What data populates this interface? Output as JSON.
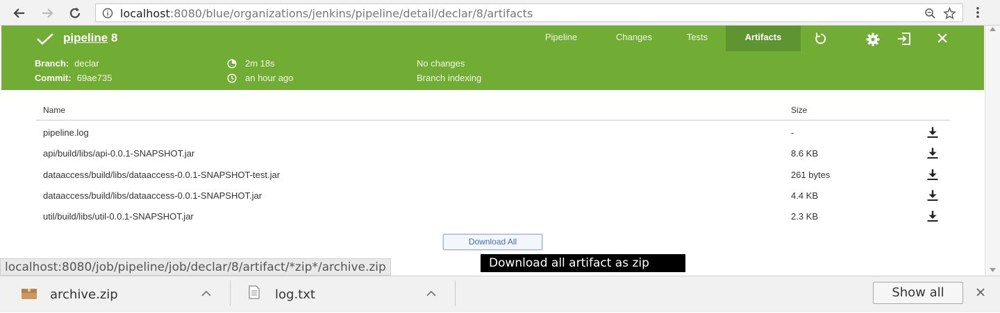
{
  "browser": {
    "url_host": "localhost",
    "url_rest": ":8080/blue/organizations/jenkins/pipeline/detail/declar/8/artifacts"
  },
  "run": {
    "pipeline_name": "pipeline",
    "run_number": "8",
    "status": "success"
  },
  "tabs": [
    {
      "label": "Pipeline",
      "active": false
    },
    {
      "label": "Changes",
      "active": false
    },
    {
      "label": "Tests",
      "active": false
    },
    {
      "label": "Artifacts",
      "active": true
    }
  ],
  "meta": {
    "branch_label": "Branch:",
    "branch_value": "declar",
    "commit_label": "Commit:",
    "commit_value": "69ae735",
    "duration": "2m 18s",
    "started": "an hour ago",
    "changes": "No changes",
    "cause": "Branch indexing"
  },
  "table": {
    "headers": {
      "name": "Name",
      "size": "Size"
    },
    "rows": [
      {
        "name": "pipeline.log",
        "size": "-"
      },
      {
        "name": "api/build/libs/api-0.0.1-SNAPSHOT.jar",
        "size": "8.6 KB"
      },
      {
        "name": "dataaccess/build/libs/dataaccess-0.0.1-SNAPSHOT-test.jar",
        "size": "261 bytes"
      },
      {
        "name": "dataaccess/build/libs/dataaccess-0.0.1-SNAPSHOT.jar",
        "size": "4.4 KB"
      },
      {
        "name": "util/build/libs/util-0.0.1-SNAPSHOT.jar",
        "size": "2.3 KB"
      }
    ]
  },
  "download_all": "Download All",
  "status_url": "localhost:8080/job/pipeline/job/declar/8/artifact/*zip*/archive.zip",
  "tooltip": "Download all artifact as zip",
  "shelf": {
    "items": [
      {
        "name": "archive.zip",
        "icon": "zip-file-icon"
      },
      {
        "name": "log.txt",
        "icon": "text-file-icon"
      }
    ],
    "show_all": "Show all"
  },
  "colors": {
    "header_green": "#71ac35",
    "active_tab": "#5f9530",
    "link_blue": "#3d6fb4"
  }
}
